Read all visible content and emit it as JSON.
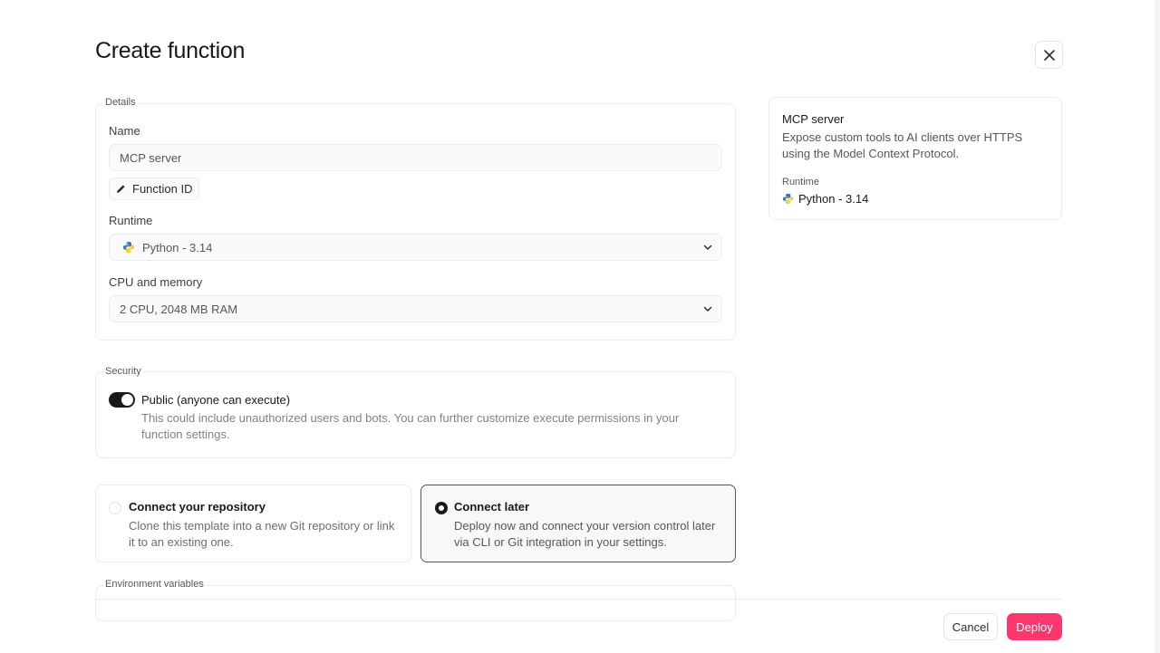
{
  "dialog": {
    "title": "Create function"
  },
  "details": {
    "legend": "Details",
    "name_label": "Name",
    "name_value": "MCP server",
    "function_id_label": "Function ID",
    "runtime_label": "Runtime",
    "runtime_value": "Python - 3.14",
    "cpu_label": "CPU and memory",
    "cpu_value": "2 CPU, 2048 MB RAM"
  },
  "security": {
    "legend": "Security",
    "toggle_enabled": true,
    "public_label": "Public (anyone can execute)",
    "public_desc": "This could include unauthorized users and bots. You can further customize execute permissions in your function settings."
  },
  "repository": {
    "options": [
      {
        "title": "Connect your repository",
        "desc": "Clone this template into a new Git repository or link it to an existing one.",
        "selected": false
      },
      {
        "title": "Connect later",
        "desc": "Deploy now and connect your version control later via CLI or Git integration in your settings.",
        "selected": true
      }
    ]
  },
  "env": {
    "legend": "Environment variables"
  },
  "summary": {
    "title": "MCP server",
    "desc": "Expose custom tools to AI clients over HTTPS using the Model Context Protocol.",
    "runtime_label": "Runtime",
    "runtime_value": "Python - 3.14"
  },
  "footer": {
    "cancel_label": "Cancel",
    "deploy_label": "Deploy"
  },
  "colors": {
    "accent": "#fd366e",
    "text": "#19191c",
    "muted": "#818187",
    "border": "#ececef",
    "toggle_on": "#19191c"
  },
  "icons": {
    "close": "close-icon",
    "edit": "pencil-icon",
    "python": "python-icon",
    "chevron": "chevron-down-icon"
  }
}
